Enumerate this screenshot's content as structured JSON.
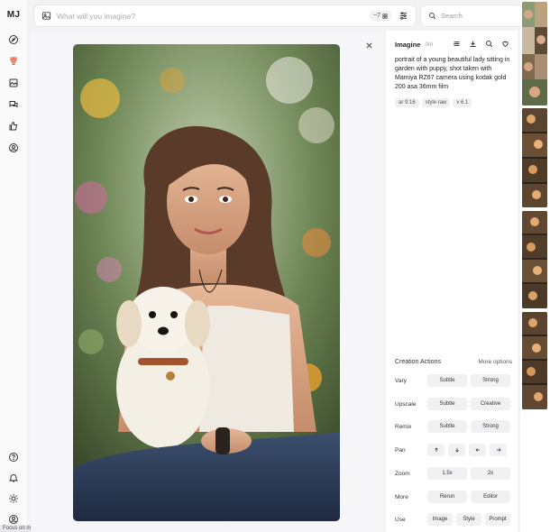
{
  "sidebar": {
    "logo": "MJ",
    "items": [
      {
        "icon": "compass-icon",
        "label": "Explore"
      },
      {
        "icon": "create-icon",
        "label": "Create"
      },
      {
        "icon": "image-icon",
        "label": "Organize"
      },
      {
        "icon": "chat-icon",
        "label": "Chat"
      },
      {
        "icon": "thumbs-up-icon",
        "label": "Rate"
      },
      {
        "icon": "user-icon",
        "label": "Profile"
      }
    ],
    "bottom": [
      "help-icon",
      "bell-icon",
      "sun-icon",
      "account-icon"
    ],
    "tooltip": "Focus on menu"
  },
  "prompt_bar": {
    "placeholder": "What will you imagine?",
    "count": "~7"
  },
  "search": {
    "placeholder": "Search"
  },
  "panel": {
    "title": "Imagine",
    "time": "0m",
    "prompt": "portrait of a young beautiful lady sitting in garden with puppy, shot taken with Mamiya RZ67 camera using kodak gold 200 asa 36mm film",
    "chips": [
      "ar 9:16",
      "style raw",
      "v 6.1"
    ],
    "actions_title": "Creation Actions",
    "more_options": "More options",
    "actions": [
      {
        "label": "Vary",
        "buttons": [
          "Subtle",
          "Strong"
        ]
      },
      {
        "label": "Upscale",
        "buttons": [
          "Subtle",
          "Creative"
        ]
      },
      {
        "label": "Remix",
        "buttons": [
          "Subtle",
          "Strong"
        ]
      },
      {
        "label": "Pan",
        "buttons": [
          "arrow-up-icon",
          "arrow-down-icon",
          "arrow-left-icon",
          "arrow-right-icon"
        ]
      },
      {
        "label": "Zoom",
        "buttons": [
          "1.5x",
          "2x"
        ]
      },
      {
        "label": "More",
        "buttons": [
          "Rerun",
          "Editor"
        ]
      },
      {
        "label": "Use",
        "buttons": [
          "Image",
          "Style",
          "Prompt"
        ]
      }
    ]
  },
  "colors": {
    "accent": "#e0533d",
    "panel_bg": "#ffffff",
    "page_bg": "#f3f3f5"
  }
}
